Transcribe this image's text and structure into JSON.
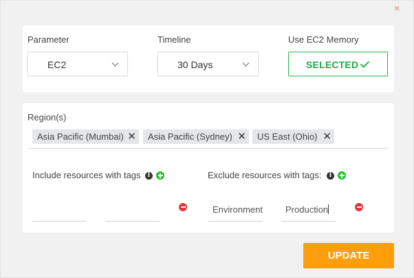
{
  "dialog": {
    "close_glyph": "×"
  },
  "top": {
    "parameter": {
      "label": "Parameter",
      "value": "EC2"
    },
    "timeline": {
      "label": "Timeline",
      "value": "30 Days"
    },
    "memory": {
      "label": "Use EC2 Memory",
      "button_label": "SELECTED"
    }
  },
  "regions": {
    "label": "Region(s)",
    "chips": [
      {
        "label": "Asia Pacific (Mumbai)"
      },
      {
        "label": "Asia Pacific (Sydney)"
      },
      {
        "label": "US East (Ohio)"
      }
    ],
    "remove_glyph": "✕"
  },
  "tags": {
    "include": {
      "label": "Include resources with tags",
      "key": "",
      "value": ""
    },
    "exclude": {
      "label": "Exclude resources with tags:",
      "key": "Environment",
      "value": "Production"
    },
    "info_glyph": "i"
  },
  "actions": {
    "update_label": "UPDATE"
  },
  "colors": {
    "accent": "#ff9e0d",
    "success": "#29b34a",
    "danger": "#e03640",
    "add": "#22c02f"
  }
}
